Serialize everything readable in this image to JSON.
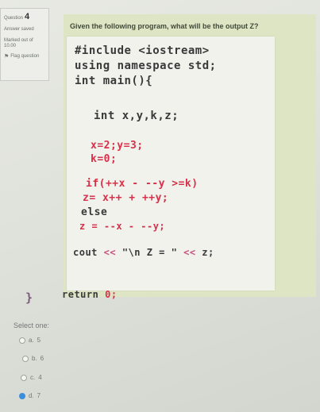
{
  "sidebar": {
    "question_word": "Question",
    "question_number": "4",
    "status": "Answer saved",
    "marked_out_of": "Marked out of",
    "marks": "10.00",
    "flag_label": "Flag question"
  },
  "question": {
    "text": "Given the following program, what will be the output Z?",
    "code": {
      "l1_keyword": "#include",
      "l1_header": "<iostream>",
      "l2": "using namespace std;",
      "l3": "int main(){",
      "l4": "int x,y,k,z;",
      "l5": "x=2;y=3;",
      "l6": "k=0;",
      "l7": "if(++x - --y >=k)",
      "l8": "z= x++ + ++y;",
      "l9": "else",
      "l10": "z = --x - --y;",
      "l11_cout": "cout",
      "l11_op1": "<<",
      "l11_str": "\"\\n Z = \"",
      "l11_op2": "<<",
      "l11_z": "z;",
      "l12_ret": "return",
      "l12_val": "0;",
      "closing": "}"
    }
  },
  "answer": {
    "select_label": "Select one:",
    "options": [
      {
        "letter": "a.",
        "value": "5",
        "selected": false
      },
      {
        "letter": "b.",
        "value": "6",
        "selected": false
      },
      {
        "letter": "c.",
        "value": "4",
        "selected": false
      },
      {
        "letter": "d.",
        "value": "7",
        "selected": true
      }
    ]
  }
}
